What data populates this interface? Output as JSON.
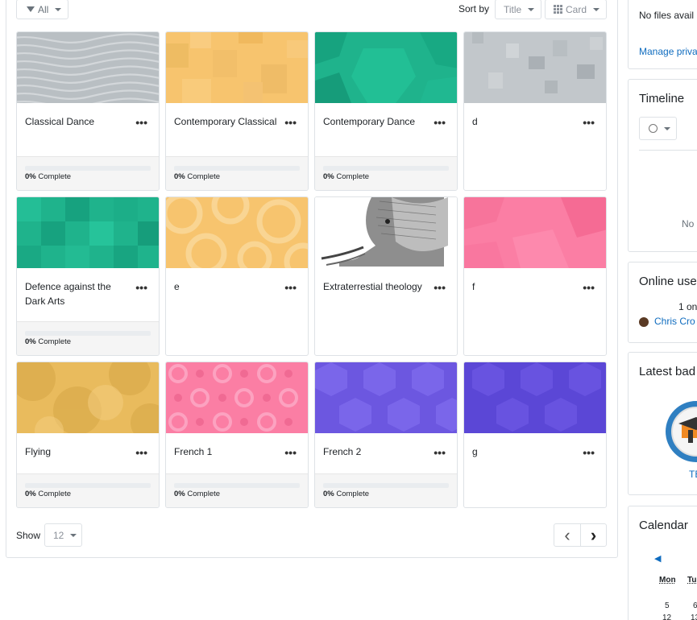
{
  "toolbar": {
    "filter_label": "All",
    "sort_by_label": "Sort by",
    "sort_value": "Title",
    "view_value": "Card"
  },
  "courses": [
    {
      "title": "Classical Dance",
      "progress_pct": 0,
      "progress_value": "0%",
      "progress_word": "Complete"
    },
    {
      "title": "Contemporary Classical",
      "progress_pct": 0,
      "progress_value": "0%",
      "progress_word": "Complete"
    },
    {
      "title": "Contemporary Dance",
      "progress_pct": 0,
      "progress_value": "0%",
      "progress_word": "Complete"
    },
    {
      "title": "d",
      "progress_pct": null,
      "progress_value": "",
      "progress_word": ""
    },
    {
      "title": "Defence against the Dark Arts",
      "progress_pct": 0,
      "progress_value": "0%",
      "progress_word": "Complete"
    },
    {
      "title": "e",
      "progress_pct": null,
      "progress_value": "",
      "progress_word": ""
    },
    {
      "title": "Extraterrestial theology",
      "progress_pct": null,
      "progress_value": "",
      "progress_word": ""
    },
    {
      "title": "f",
      "progress_pct": null,
      "progress_value": "",
      "progress_word": ""
    },
    {
      "title": "Flying",
      "progress_pct": 0,
      "progress_value": "0%",
      "progress_word": "Complete"
    },
    {
      "title": "French 1",
      "progress_pct": 0,
      "progress_value": "0%",
      "progress_word": "Complete"
    },
    {
      "title": "French 2",
      "progress_pct": 0,
      "progress_value": "0%",
      "progress_word": "Complete"
    },
    {
      "title": "g",
      "progress_pct": null,
      "progress_value": "",
      "progress_word": ""
    }
  ],
  "course_menu_glyph": "•••",
  "pagination": {
    "show_label": "Show",
    "per_page": "12",
    "prev_glyph": "‹",
    "next_glyph": "›"
  },
  "sidebar": {
    "private_files": {
      "empty_text": "No files avail",
      "manage_link": "Manage priva"
    },
    "timeline": {
      "title": "Timeline",
      "empty_text": "No"
    },
    "online_users": {
      "title": "Online use",
      "count_text": "1 on",
      "user_name": "Chris Cro"
    },
    "badges": {
      "title": "Latest bad",
      "badge_caption": "TE"
    },
    "calendar": {
      "title": "Calendar",
      "prev_glyph": "◀",
      "day_mon": "Mon",
      "day_tue": "Tu",
      "row1_mon": "5",
      "row1_tue": "6",
      "row2_mon": "12",
      "row2_tue": "13"
    }
  },
  "colors": {
    "accent": "#0f6cbf",
    "border": "#dee2e6",
    "progress_track": "#e9ecef",
    "footer_bg": "#f5f5f5"
  }
}
